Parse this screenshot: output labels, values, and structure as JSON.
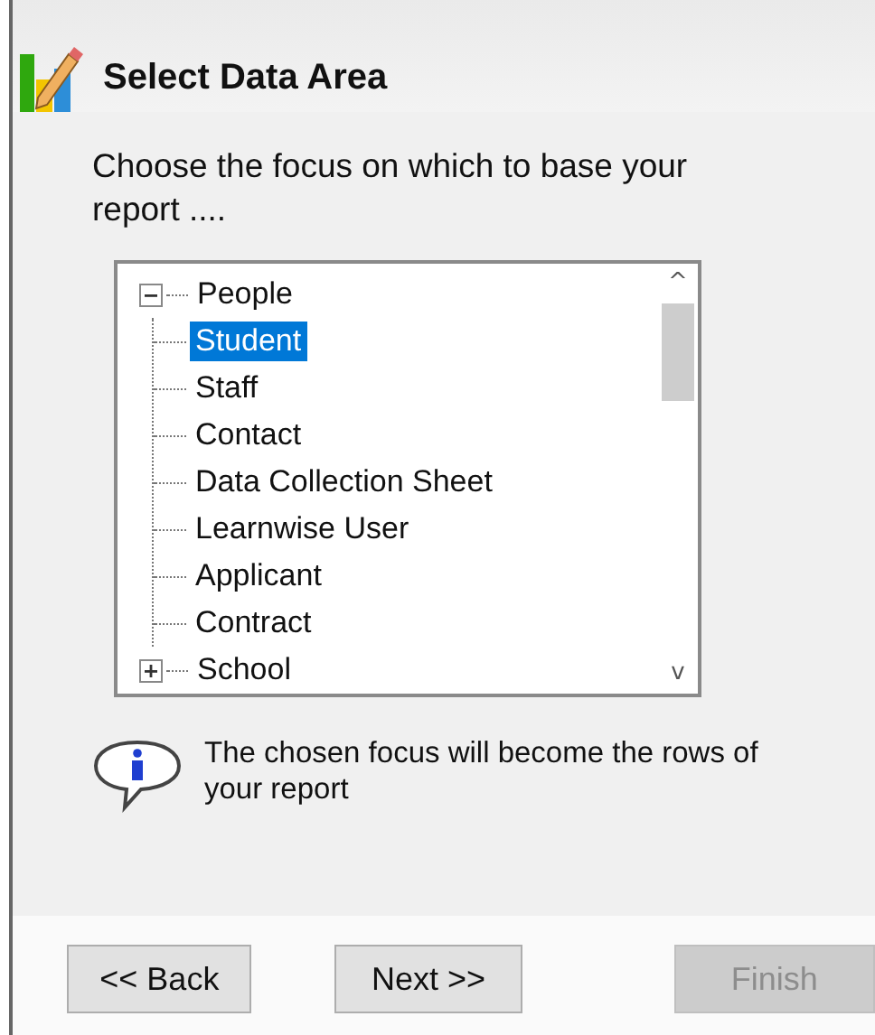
{
  "header": {
    "title": "Select Data Area"
  },
  "instruction": "Choose the focus on which to base your report ....",
  "tree": [
    {
      "label": "People",
      "expanded": true,
      "selected": false,
      "children": [
        {
          "label": "Student",
          "selected": true
        },
        {
          "label": "Staff",
          "selected": false
        },
        {
          "label": "Contact",
          "selected": false
        },
        {
          "label": "Data Collection Sheet",
          "selected": false
        },
        {
          "label": "Learnwise User",
          "selected": false
        },
        {
          "label": "Applicant",
          "selected": false
        },
        {
          "label": "Contract",
          "selected": false
        }
      ]
    },
    {
      "label": "School",
      "expanded": false,
      "selected": false
    }
  ],
  "scroll_up": "^",
  "scroll_down": "v",
  "info": "The chosen focus will become the rows of your report",
  "buttons": [
    {
      "label": "<< Back",
      "disabled": false
    },
    {
      "label": "Next >>",
      "disabled": false
    },
    {
      "label": "Finish",
      "disabled": true
    }
  ]
}
